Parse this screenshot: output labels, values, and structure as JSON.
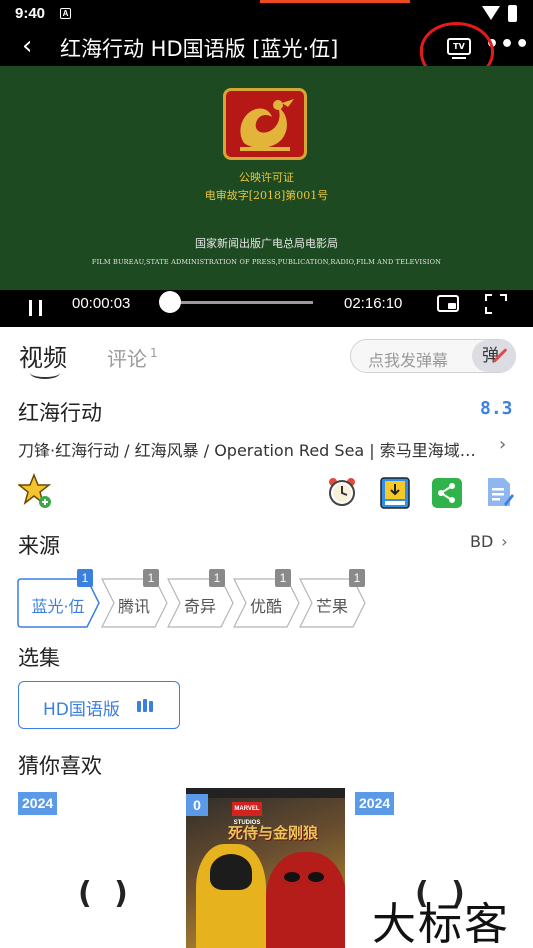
{
  "status_bar": {
    "time": "9:40",
    "notification_icon": "A"
  },
  "header": {
    "title": "红海行动 HD国语版 [蓝光·伍]",
    "back_glyph": "‹",
    "tv_label": "TV",
    "more_glyph": "•••"
  },
  "video": {
    "license_line1": "公映许可证",
    "license_line2": "电审故字[2018]第001号",
    "bureau_cn": "国家新闻出版广电总局电影局",
    "bureau_en": "FILM BUREAU,STATE ADMINISTRATION OF PRESS,PUBLICATION,RADIO,FILM AND TELEVISION",
    "current_time": "00:00:03",
    "duration": "02:16:10",
    "progress": 0.0004
  },
  "tabs": {
    "video": "视频",
    "comments": "评论",
    "comments_count": "1"
  },
  "danmaku": {
    "placeholder": "点我发弹幕",
    "toggle_label": "弹"
  },
  "movie": {
    "title": "红海行动",
    "rating": "8.3",
    "aliases": "刀锋·红海行动 / 红海风暴 / Operation Red Sea | 索马里海域…"
  },
  "source": {
    "title": "来源",
    "current": "BD",
    "items": [
      {
        "label": "蓝光·伍",
        "count": "1",
        "active": true
      },
      {
        "label": "腾讯",
        "count": "1",
        "active": false
      },
      {
        "label": "奇异",
        "count": "1",
        "active": false
      },
      {
        "label": "优酷",
        "count": "1",
        "active": false
      },
      {
        "label": "芒果",
        "count": "1",
        "active": false
      }
    ]
  },
  "episodes": {
    "title": "选集",
    "items": [
      {
        "label": "HD国语版"
      }
    ]
  },
  "recommend": {
    "title": "猜你喜欢",
    "cards": [
      {
        "year": "2024"
      },
      {
        "year": "0",
        "poster_title": "死侍与金刚狼",
        "studio": "MARVEL STUDIOS"
      },
      {
        "year": "2024"
      }
    ]
  },
  "watermark": "大标客",
  "colors": {
    "accent": "#3b7fe0",
    "rating": "#3b80e6",
    "annotation": "#e51b1b",
    "video_bg": "#1e4a22"
  }
}
